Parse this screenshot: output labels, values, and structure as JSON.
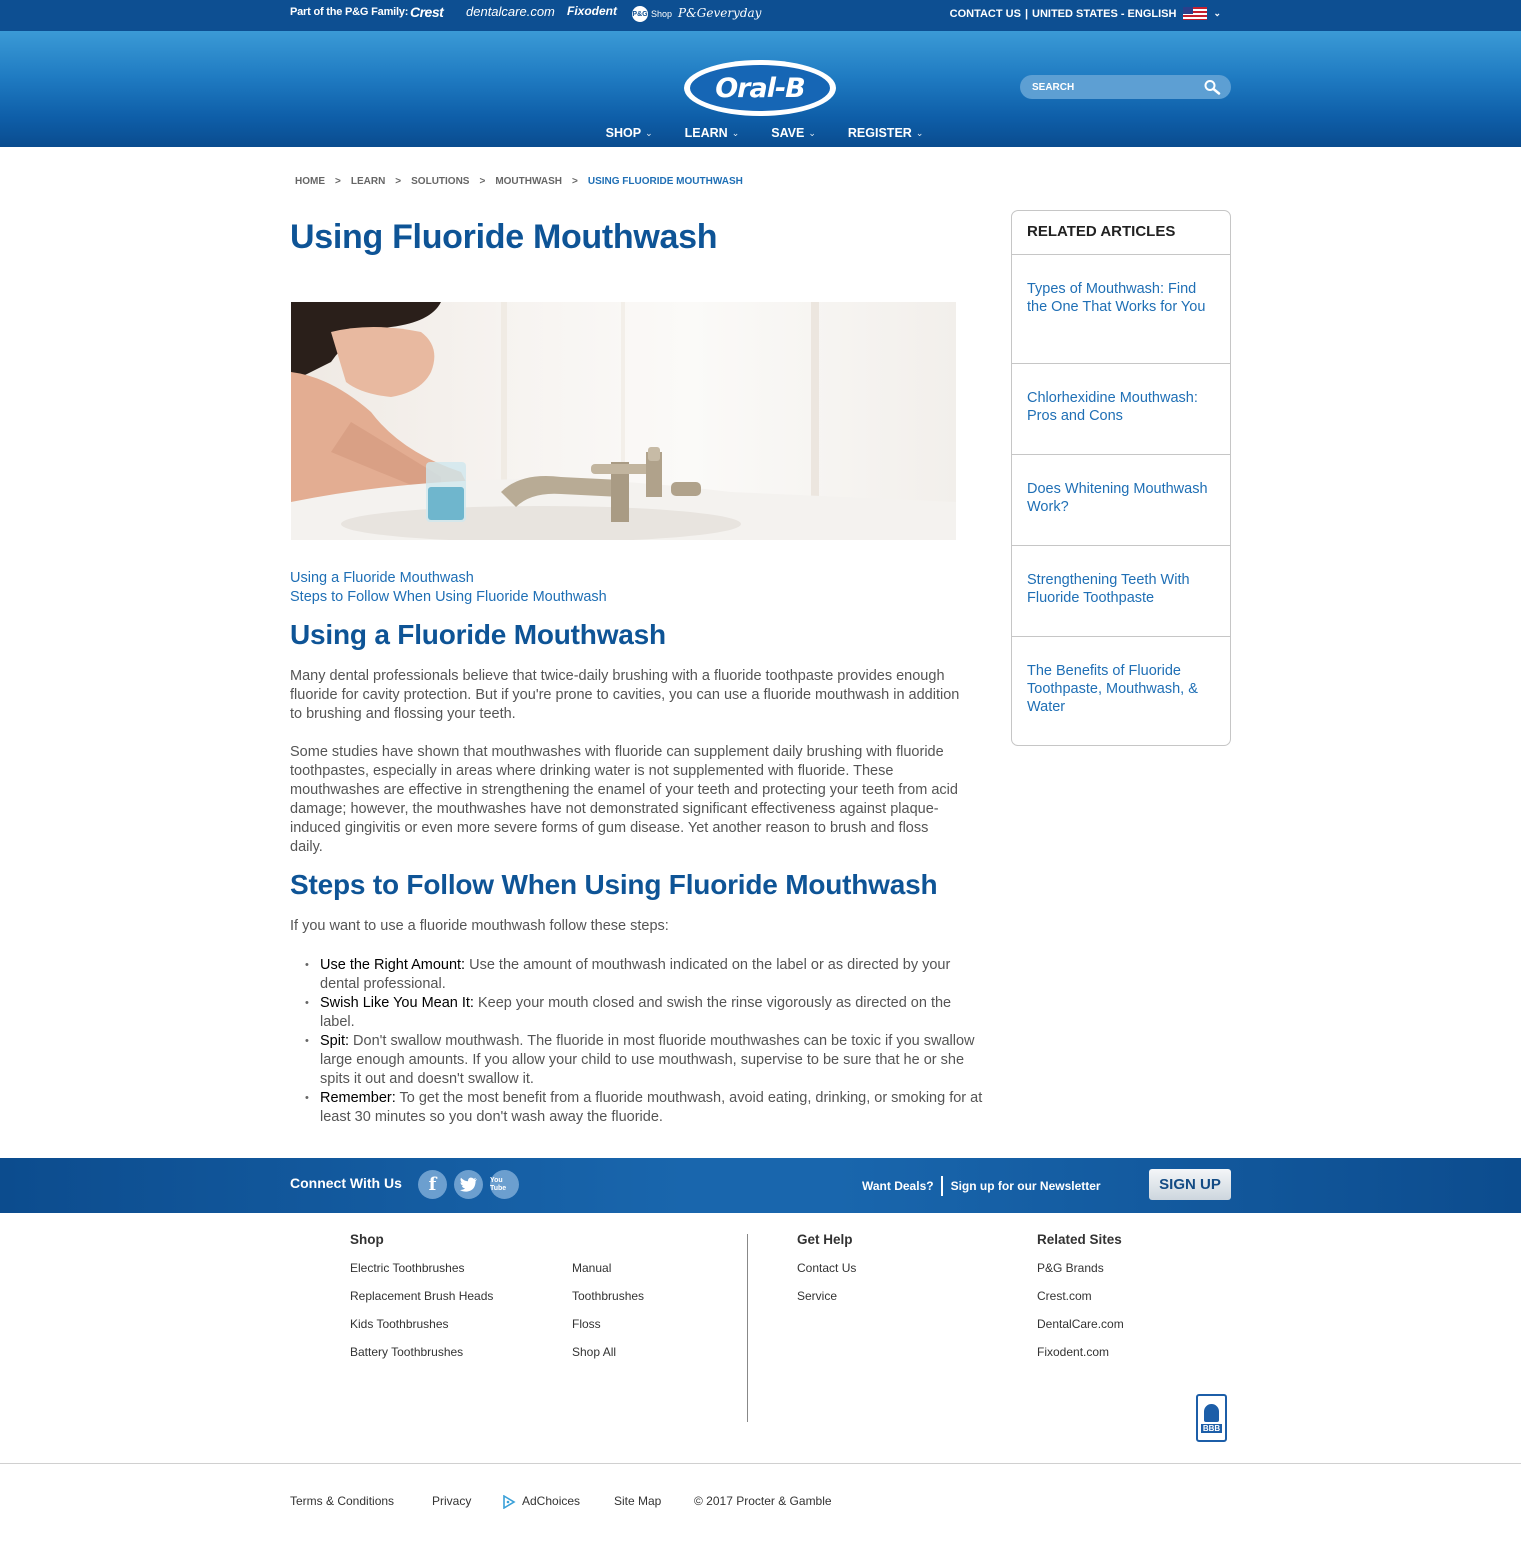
{
  "topbar": {
    "family_label": "Part of the P&G Family:",
    "brands": [
      "Crest",
      "dentalcare.com",
      "Fixodent",
      "Shop",
      "P&Geveryday"
    ],
    "pg_badge": "P&G",
    "contact": "CONTACT US",
    "region": "UNITED STATES - ENGLISH"
  },
  "header": {
    "logo": "Oral-B",
    "search_placeholder": "SEARCH",
    "nav": [
      "SHOP",
      "LEARN",
      "SAVE",
      "REGISTER"
    ]
  },
  "breadcrumb": [
    "HOME",
    "LEARN",
    "SOLUTIONS",
    "MOUTHWASH",
    "USING FLUORIDE MOUTHWASH"
  ],
  "article": {
    "title": "Using Fluoride Mouthwash",
    "toc": [
      "Using a Fluoride Mouthwash",
      "Steps to Follow When Using Fluoride Mouthwash"
    ],
    "section1_heading": "Using a Fluoride Mouthwash",
    "section1_p1": "Many dental professionals believe that twice-daily brushing with a fluoride toothpaste provides enough fluoride for cavity protection. But if you're prone to cavities, you can use a fluoride mouthwash in addition to brushing and flossing your teeth.",
    "section1_p2": "Some studies have shown that mouthwashes with fluoride can supplement daily brushing with fluoride toothpastes, especially in areas where drinking water is not supplemented with fluoride. These mouthwashes are effective in strengthening the enamel of your teeth and protecting your teeth from acid damage; however, the mouthwashes have not demonstrated significant effectiveness against plaque-induced gingivitis or even more severe forms of gum disease. Yet another reason to brush and floss daily.",
    "section2_heading": "Steps to Follow When Using Fluoride Mouthwash",
    "section2_intro": "If you want to use a fluoride mouthwash follow these steps:",
    "steps": [
      {
        "term": "Use the Right Amount:",
        "text": " Use the amount of mouthwash indicated on the label or as directed by your dental professional."
      },
      {
        "term": "Swish Like You Mean It:",
        "text": " Keep your mouth closed and swish the rinse vigorously as directed on the label."
      },
      {
        "term": "Spit:",
        "text": " Don't swallow mouthwash. The fluoride in most fluoride mouthwashes can be toxic if you swallow large enough amounts. If you allow your child to use mouthwash, supervise to be sure that he or she spits it out and doesn't swallow it."
      },
      {
        "term": "Remember:",
        "text": " To get the most benefit from a fluoride mouthwash, avoid eating, drinking, or smoking for at least 30 minutes so you don't wash away the fluoride."
      }
    ]
  },
  "related": {
    "heading": "RELATED ARTICLES",
    "items": [
      "Types of Mouthwash: Find the One That Works for You",
      "Chlorhexidine Mouthwash: Pros and Cons",
      "Does Whitening Mouthwash Work?",
      "Strengthening Teeth With Fluoride Toothpaste",
      "The Benefits of Fluoride Toothpaste, Mouthwash, & Water"
    ]
  },
  "connect": {
    "label": "Connect With Us",
    "social_icons": [
      "facebook-icon",
      "twitter-icon",
      "youtube-icon"
    ],
    "youtube_text": "You Tube",
    "deals": "Want Deals?",
    "newsletter": "Sign up for our Newsletter",
    "signup_label": "SIGN UP"
  },
  "footer": {
    "shop_title": "Shop",
    "shop_col1": [
      "Electric Toothbrushes",
      "Replacement Brush Heads",
      "Kids Toothbrushes",
      "Battery Toothbrushes"
    ],
    "shop_col2": [
      "Manual",
      "Toothbrushes",
      "Floss",
      "Shop All"
    ],
    "help_title": "Get Help",
    "help_links": [
      "Contact Us",
      "Service"
    ],
    "related_title": "Related Sites",
    "related_links": [
      "P&G Brands",
      "Crest.com",
      "DentalCare.com",
      "Fixodent.com"
    ],
    "bbb": "BBB",
    "legal": [
      "Terms & Conditions",
      "Privacy",
      "AdChoices",
      "Site Map",
      "© 2017 Procter & Gamble"
    ]
  },
  "colors": {
    "brand_blue": "#0e5496",
    "link_blue": "#1f6fb5",
    "topbar": "#0d4f92"
  }
}
